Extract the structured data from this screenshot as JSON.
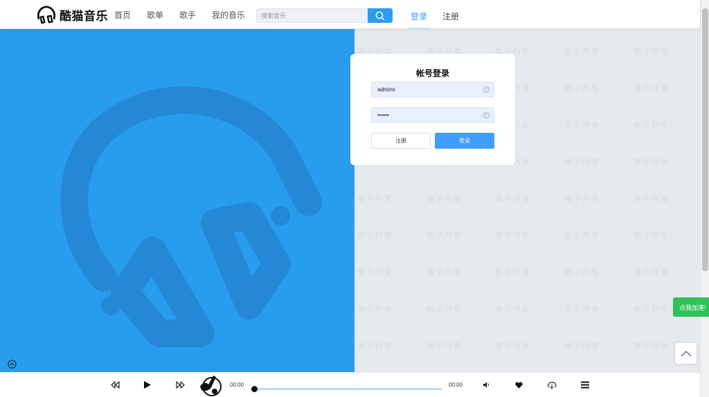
{
  "header": {
    "logo_text": "酷猫音乐",
    "nav": [
      "首页",
      "歌单",
      "歌手",
      "我的音乐"
    ],
    "search_placeholder": "搜索音乐",
    "login": "登录",
    "register": "注册"
  },
  "login_card": {
    "title": "帐号登录",
    "username_value": "admins",
    "password_value": "••••••",
    "register_button": "注册",
    "login_button": "登录"
  },
  "floating": {
    "green_button": "点我加速!"
  },
  "player": {
    "current_time": "00:00",
    "total_time": "00:00",
    "progress": 0
  },
  "watermark_text": "傲子丹爱",
  "colors": {
    "blue_panel": "#289ded",
    "primary": "#409eff",
    "green": "#2fc25b"
  }
}
